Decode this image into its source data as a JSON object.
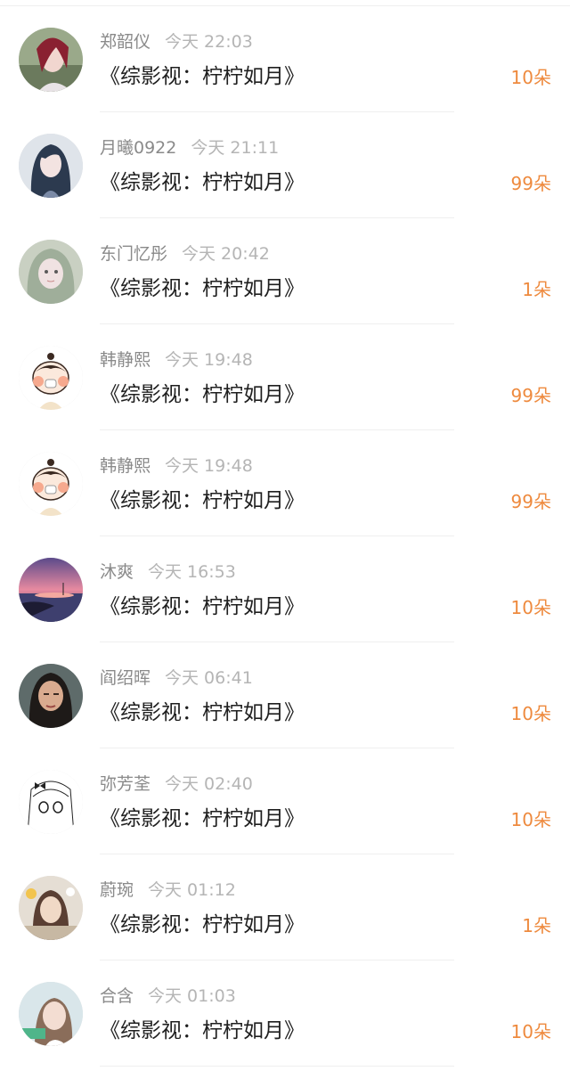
{
  "items": [
    {
      "user": "郑韶仪",
      "time": "今天 22:03",
      "title": "《综影视：柠柠如月》",
      "gift": "10朵",
      "avatar": "portrait-avatar-1"
    },
    {
      "user": "月曦0922",
      "time": "今天 21:11",
      "title": "《综影视：柠柠如月》",
      "gift": "99朵",
      "avatar": "portrait-avatar-2"
    },
    {
      "user": "东门忆彤",
      "time": "今天 20:42",
      "title": "《综影视：柠柠如月》",
      "gift": "1朵",
      "avatar": "portrait-avatar-3"
    },
    {
      "user": "韩静熙",
      "time": "今天 19:48",
      "title": "《综影视：柠柠如月》",
      "gift": "99朵",
      "avatar": "cartoon-avatar-1"
    },
    {
      "user": "韩静熙",
      "time": "今天 19:48",
      "title": "《综影视：柠柠如月》",
      "gift": "99朵",
      "avatar": "cartoon-avatar-2"
    },
    {
      "user": "沐爽",
      "time": "今天 16:53",
      "title": "《综影视：柠柠如月》",
      "gift": "10朵",
      "avatar": "sunset-avatar"
    },
    {
      "user": "阎绍晖",
      "time": "今天 06:41",
      "title": "《综影视：柠柠如月》",
      "gift": "10朵",
      "avatar": "portrait-avatar-4"
    },
    {
      "user": "弥芳荃",
      "time": "今天 02:40",
      "title": "《综影视：柠柠如月》",
      "gift": "10朵",
      "avatar": "sketch-avatar"
    },
    {
      "user": "蔚琬",
      "time": "今天 01:12",
      "title": "《综影视：柠柠如月》",
      "gift": "1朵",
      "avatar": "portrait-avatar-5"
    },
    {
      "user": "合含",
      "time": "今天 01:03",
      "title": "《综影视：柠柠如月》",
      "gift": "10朵",
      "avatar": "portrait-avatar-6"
    }
  ]
}
